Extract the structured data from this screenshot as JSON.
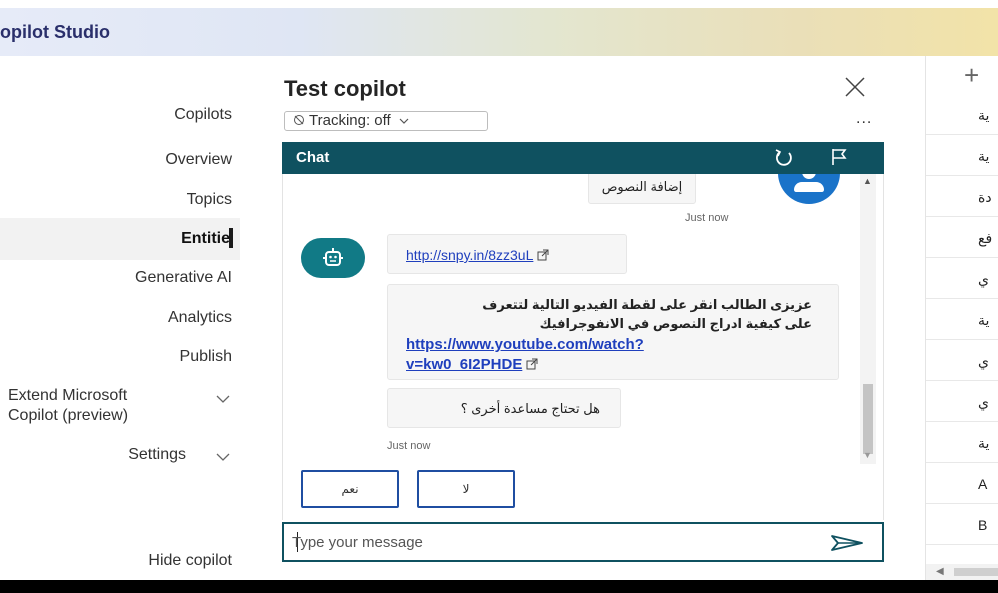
{
  "app": {
    "title": "opilot Studio"
  },
  "nav": {
    "copilots": "Copilots",
    "overview": "Overview",
    "topics": "Topics",
    "entities": "Entitie",
    "generative_ai": "Generative AI",
    "analytics": "Analytics",
    "publish": "Publish",
    "extend_line1": "Extend Microsoft",
    "extend_line2": "Copilot (preview)",
    "settings": "Settings",
    "hide": "Hide copilot"
  },
  "test_panel": {
    "title": "Test copilot",
    "tracking": "Tracking: off",
    "more": "..."
  },
  "chat": {
    "header": "Chat",
    "user_message": "إضافة النصوص",
    "user_timestamp": "Just now",
    "link": "http://snpy.in/8zz3uL",
    "message_line1": "عزيزى الطالب انقر على لقطة الفيديو التالية لتتعرف",
    "message_line2": "على كيفية ادراج النصوص في الانفوجرافيك",
    "youtube_link_line1": "https://www.youtube.com/watch?",
    "youtube_link_line2": "v=kw0_6I2PHDE",
    "question": "هل تحتاج مساعدة أخرى ؟",
    "bot_timestamp": "Just now",
    "suggestion_yes": "نعم",
    "suggestion_no": "لا",
    "input_placeholder": "Type your message"
  },
  "right_panel": {
    "rows": [
      "ية",
      "ية",
      "دة",
      "فع",
      "ي",
      "ية",
      "ي",
      "ي",
      "ية",
      "A",
      "B"
    ]
  },
  "colors": {
    "chat_header": "#0f5160",
    "bot_avatar": "#117a86",
    "user_avatar": "#1a73c9",
    "link": "#1f3fbd",
    "suggestion_border": "#1f4ea1"
  }
}
